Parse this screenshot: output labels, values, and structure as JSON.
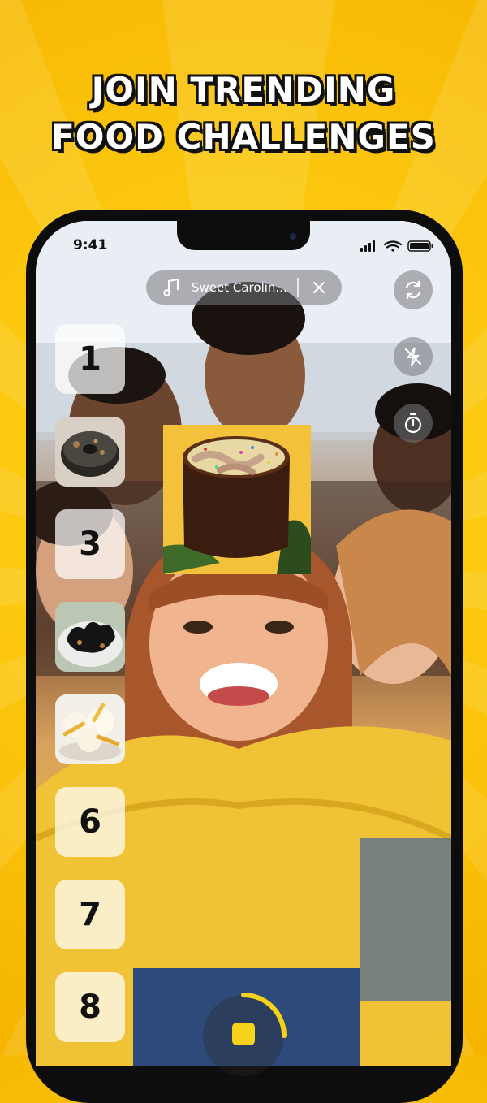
{
  "headline": {
    "line1": "JOIN TRENDING",
    "line2": "FOOD CHALLENGES"
  },
  "status_bar": {
    "time": "9:41",
    "icons": [
      "cellular-signal-icon",
      "wifi-icon",
      "battery-icon"
    ]
  },
  "music_pill": {
    "icon": "music-note-icon",
    "song_title": "Sweet Carolin...",
    "close_icon": "close-icon"
  },
  "side_controls": [
    "flip-camera-icon",
    "flash-off-icon",
    "timer-icon"
  ],
  "challenge_slots": [
    {
      "type": "number",
      "label": "1"
    },
    {
      "type": "image",
      "subject": "burnt donut"
    },
    {
      "type": "number",
      "label": "3"
    },
    {
      "type": "image",
      "subject": "charred dish on plate"
    },
    {
      "type": "image",
      "subject": "ice cream with fries"
    },
    {
      "type": "number",
      "label": "6"
    },
    {
      "type": "number",
      "label": "7"
    },
    {
      "type": "number",
      "label": "8"
    }
  ],
  "featured_challenge": {
    "subject": "sausages in soup with sprinkles in a mug"
  },
  "capture": {
    "progress": 0.25,
    "accent": "#f7d21a"
  },
  "colors": {
    "background": "#fbc40c",
    "headline_fill": "#ffffff",
    "headline_outline": "#111111"
  }
}
